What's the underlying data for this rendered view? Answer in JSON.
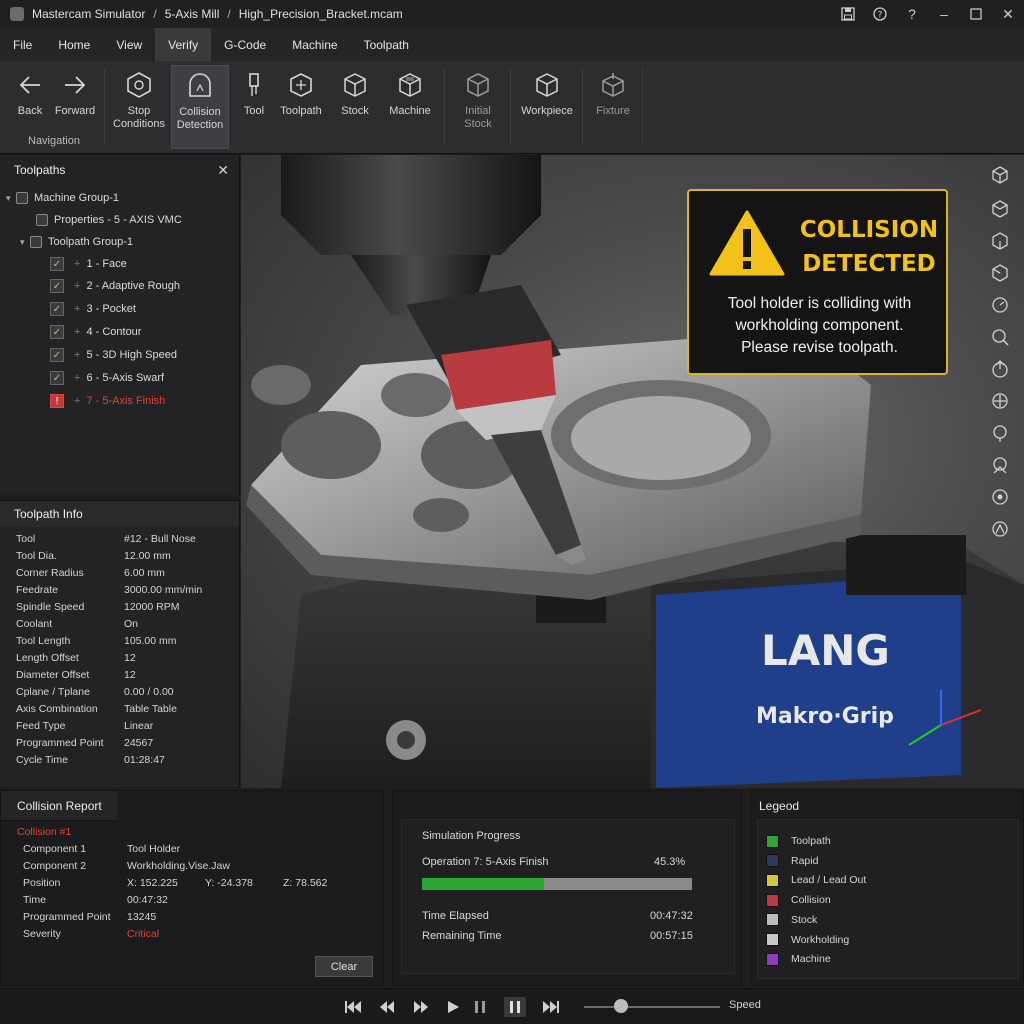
{
  "titlebar": {
    "app": "Mastercam Simulator",
    "mode": "5-Axis Mill",
    "file": "High_Precision_Bracket.mcam",
    "separator": "/"
  },
  "menu": [
    "File",
    "Home",
    "View",
    "Verify",
    "G-Code",
    "Machine",
    "Toolpath"
  ],
  "ribbon": {
    "back": "Back",
    "forward": "Forward",
    "navigation_group": "Navigation",
    "stop": "Stop",
    "conditions": "Conditions",
    "collision": "Collision",
    "detection": "Detection",
    "tool": "Tool",
    "toolpath": "Toolpath",
    "stock": "Stock",
    "machine": "Machine",
    "initial": "Initial",
    "initial_stock": "Stock",
    "workpiece": "Workpiece",
    "fixture": "Fixture"
  },
  "toolpaths_panel": {
    "title": "Toolpaths",
    "machine_group": "Machine Group-1",
    "properties": "Properties - 5 - AXIS VMC",
    "toolpath_group": "Toolpath Group-1",
    "ops": [
      {
        "label": "1 - Face",
        "status": "ok"
      },
      {
        "label": "2 - Adaptive Rough",
        "status": "ok"
      },
      {
        "label": "3 - Pocket",
        "status": "ok"
      },
      {
        "label": "4 - Contour",
        "status": "ok"
      },
      {
        "label": "5 - 3D High Speed",
        "status": "ok"
      },
      {
        "label": "6 - 5-Axis Swarf",
        "status": "ok"
      },
      {
        "label": "7 - 5-Axis Finish",
        "status": "error"
      }
    ]
  },
  "toolpath_info": {
    "title": "Toolpath Info",
    "rows": [
      {
        "k": "Tool",
        "v": "#12 - Bull Nose"
      },
      {
        "k": "Tool Dia.",
        "v": "12.00 mm"
      },
      {
        "k": "Corner Radius",
        "v": "6.00 mm"
      },
      {
        "k": "Feedrate",
        "v": "3000.00 mm/min"
      },
      {
        "k": "Spindle Speed",
        "v": "12000 RPM"
      },
      {
        "k": "Coolant",
        "v": "On"
      },
      {
        "k": "Tool Length",
        "v": "105.00 mm"
      },
      {
        "k": "Length Offset",
        "v": "12"
      },
      {
        "k": "Diameter Offset",
        "v": "12"
      },
      {
        "k": "Cplane / Tplane",
        "v": "0.00 / 0.00"
      },
      {
        "k": "Axis Combination",
        "v": "Table Table"
      },
      {
        "k": "Feed Type",
        "v": "Linear"
      },
      {
        "k": "Programmed Point",
        "v": "24567"
      },
      {
        "k": "Cycle Time",
        "v": "01:28:47"
      }
    ]
  },
  "alert": {
    "title_line1": "COLLISION",
    "title_line2": "DETECTED",
    "msg_line1": "Tool holder is colliding with",
    "msg_line2": "workholding component.",
    "msg_line3": "Please revise toolpath."
  },
  "viewport": {
    "brand": "LANG",
    "product": "Makro·Grip"
  },
  "collision_report": {
    "title": "Collision Report",
    "collision_id": "Collision #1",
    "component1_label": "Component 1",
    "component1": "Tool Holder",
    "component2_label": "Component 2",
    "component2": "Workholding.Vise.Jaw",
    "position_label": "Position",
    "x": "X:  152.225",
    "y": "Y:  -24.378",
    "z": "Z:  78.562",
    "time_label": "Time",
    "time": "00:47:32",
    "prog_point_label": "Programmed Point",
    "prog_point": "13245",
    "severity_label": "Severity",
    "severity": "Critical",
    "clear": "Clear"
  },
  "progress": {
    "title": "Simulation Progress",
    "operation": "Operation 7: 5-Axis Finish",
    "percent_text": "45.3%",
    "percent": 45.3,
    "elapsed_label": "Time Elapsed",
    "elapsed": "00:47:32",
    "remaining_label": "Remaining Time",
    "remaining": "00:57:15"
  },
  "legend": {
    "title": "Legeod",
    "items": [
      {
        "label": "Toolpath",
        "color": "#2ea435"
      },
      {
        "label": "Rapid",
        "color": "#2c3a5c"
      },
      {
        "label": "Lead / Lead Out",
        "color": "#d8c43a"
      },
      {
        "label": "Collision",
        "color": "#c0393d"
      },
      {
        "label": "Stock",
        "color": "#bdbdbd"
      },
      {
        "label": "Workholding",
        "color": "#c9c9c9"
      },
      {
        "label": "Machine",
        "color": "#8a3fbf"
      }
    ]
  },
  "playback": {
    "speed_label": "Speed"
  }
}
